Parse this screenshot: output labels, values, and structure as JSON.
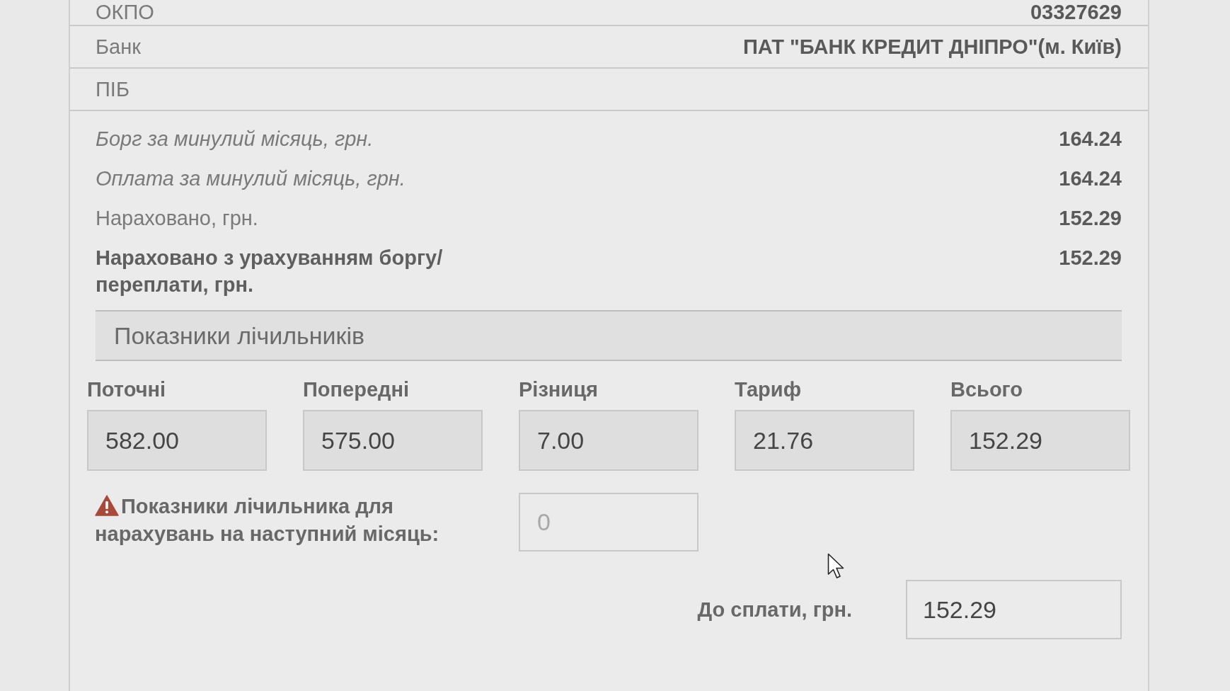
{
  "details": [
    {
      "label": "ОКПО",
      "value": "03327629"
    },
    {
      "label": "Банк",
      "value": "ПАТ \"БАНК КРЕДИТ ДНІПРО\"(м. Київ)"
    },
    {
      "label": "ПІБ"
    }
  ],
  "totals": [
    {
      "kind": "italic",
      "label": "Борг за минулий місяць, грн.",
      "value": "164.24"
    },
    {
      "kind": "italic",
      "label": "Оплата за минулий місяць, грн.",
      "value": "164.24"
    },
    {
      "kind": "plain",
      "label": "Нараховано, грн.",
      "value": "152.29"
    },
    {
      "kind": "bold",
      "label": "Нараховано з урахуванням боргу/ переплати, грн.",
      "value": "152.29"
    }
  ],
  "meters": {
    "title": "Показники лічильників",
    "columns": [
      {
        "label": "Поточні",
        "value": "582.00",
        "disabled": true
      },
      {
        "label": "Попередні",
        "value": "575.00",
        "disabled": true
      },
      {
        "label": "Різниця",
        "value": "7.00",
        "disabled": true
      },
      {
        "label": "Тариф",
        "value": "21.76",
        "disabled": true
      },
      {
        "label": "Всього",
        "value": "152.29",
        "disabled": true
      }
    ]
  },
  "next_reading": {
    "warning": true,
    "label": "Показники лічильника для нарахувань на наступний місяць:",
    "placeholder": "0"
  },
  "payment": {
    "label": "До сплати, грн.",
    "value": "152.29"
  }
}
